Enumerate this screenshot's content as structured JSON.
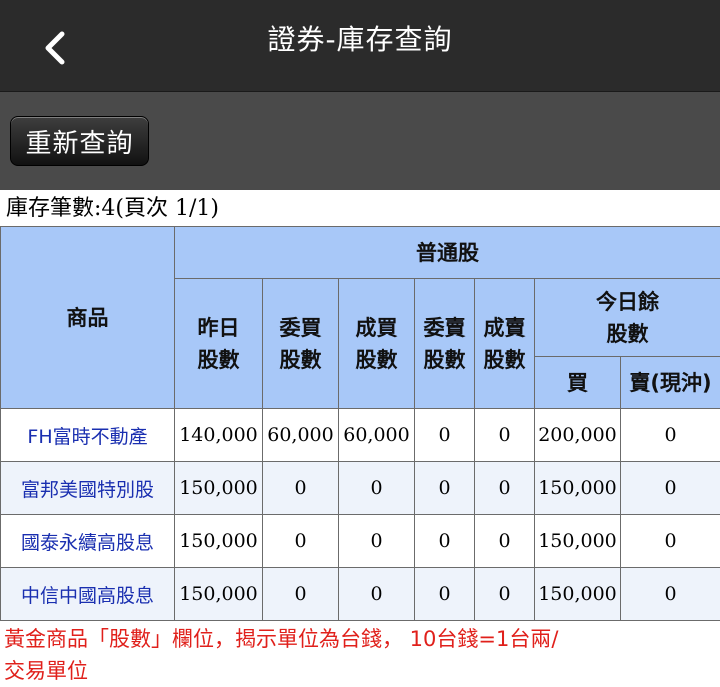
{
  "header": {
    "title": "證券-庫存查詢",
    "back_icon": "chevron-left-icon"
  },
  "toolbar": {
    "refresh_label": "重新查詢"
  },
  "summary": {
    "count_text": "庫存筆數:4(頁次 1/1)"
  },
  "table": {
    "headers": {
      "product": "商品",
      "group_common": "普通股",
      "yesterday": "昨日股數",
      "bid": "委買股數",
      "bought": "成買股數",
      "ask": "委賣股數",
      "sold": "成賣股數",
      "today_balance": "今日餘股數",
      "buy": "買",
      "sell": "賣(現沖)"
    },
    "rows": [
      {
        "product": "FH富時不動產",
        "yesterday": "140,000",
        "bid": "60,000",
        "bought": "60,000",
        "ask": "0",
        "sold": "0",
        "buy": "200,000",
        "sell": "0"
      },
      {
        "product": "富邦美國特別股",
        "yesterday": "150,000",
        "bid": "0",
        "bought": "0",
        "ask": "0",
        "sold": "0",
        "buy": "150,000",
        "sell": "0"
      },
      {
        "product": "國泰永續高股息",
        "yesterday": "150,000",
        "bid": "0",
        "bought": "0",
        "ask": "0",
        "sold": "0",
        "buy": "150,000",
        "sell": "0"
      },
      {
        "product": "中信中國高股息",
        "yesterday": "150,000",
        "bid": "0",
        "bought": "0",
        "ask": "0",
        "sold": "0",
        "buy": "150,000",
        "sell": "0"
      }
    ]
  },
  "footer": {
    "note": "黃金商品「股數」欄位，揭示單位為台錢， 10台錢=1台兩/交易單位"
  },
  "colors": {
    "header_bg": "#a8c8f8",
    "link": "#1a2fb0",
    "note": "#e0201b",
    "topbar": "#2b2b2b",
    "toolbar": "#4a4a4a"
  }
}
